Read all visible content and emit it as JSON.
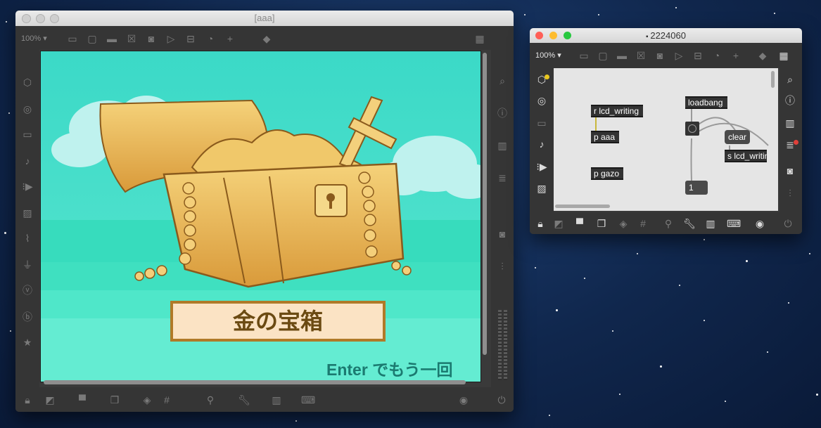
{
  "left_window": {
    "title": "[aaa]",
    "zoom": "100%",
    "game": {
      "title": "金の宝箱",
      "prompt": "Enter でもう一回"
    }
  },
  "right_window": {
    "title": "2224060",
    "zoom": "100%",
    "objects": {
      "r_lcd": "r lcd_writing",
      "p_aaa": "p aaa",
      "p_gazo": "p gazo",
      "loadbang": "loadbang",
      "clear": "clear",
      "s_lcd": "s lcd_writing",
      "number": "1"
    }
  },
  "colors": {
    "desktop": "#10274d",
    "window_dark": "#3a3a3a",
    "sea": "#3ee0c0",
    "sky": "#44dcc9",
    "gold": "#e6b04a",
    "banner_border": "#b07a28",
    "banner_text": "#6b4a12",
    "prompt_text": "#1b7a70"
  }
}
